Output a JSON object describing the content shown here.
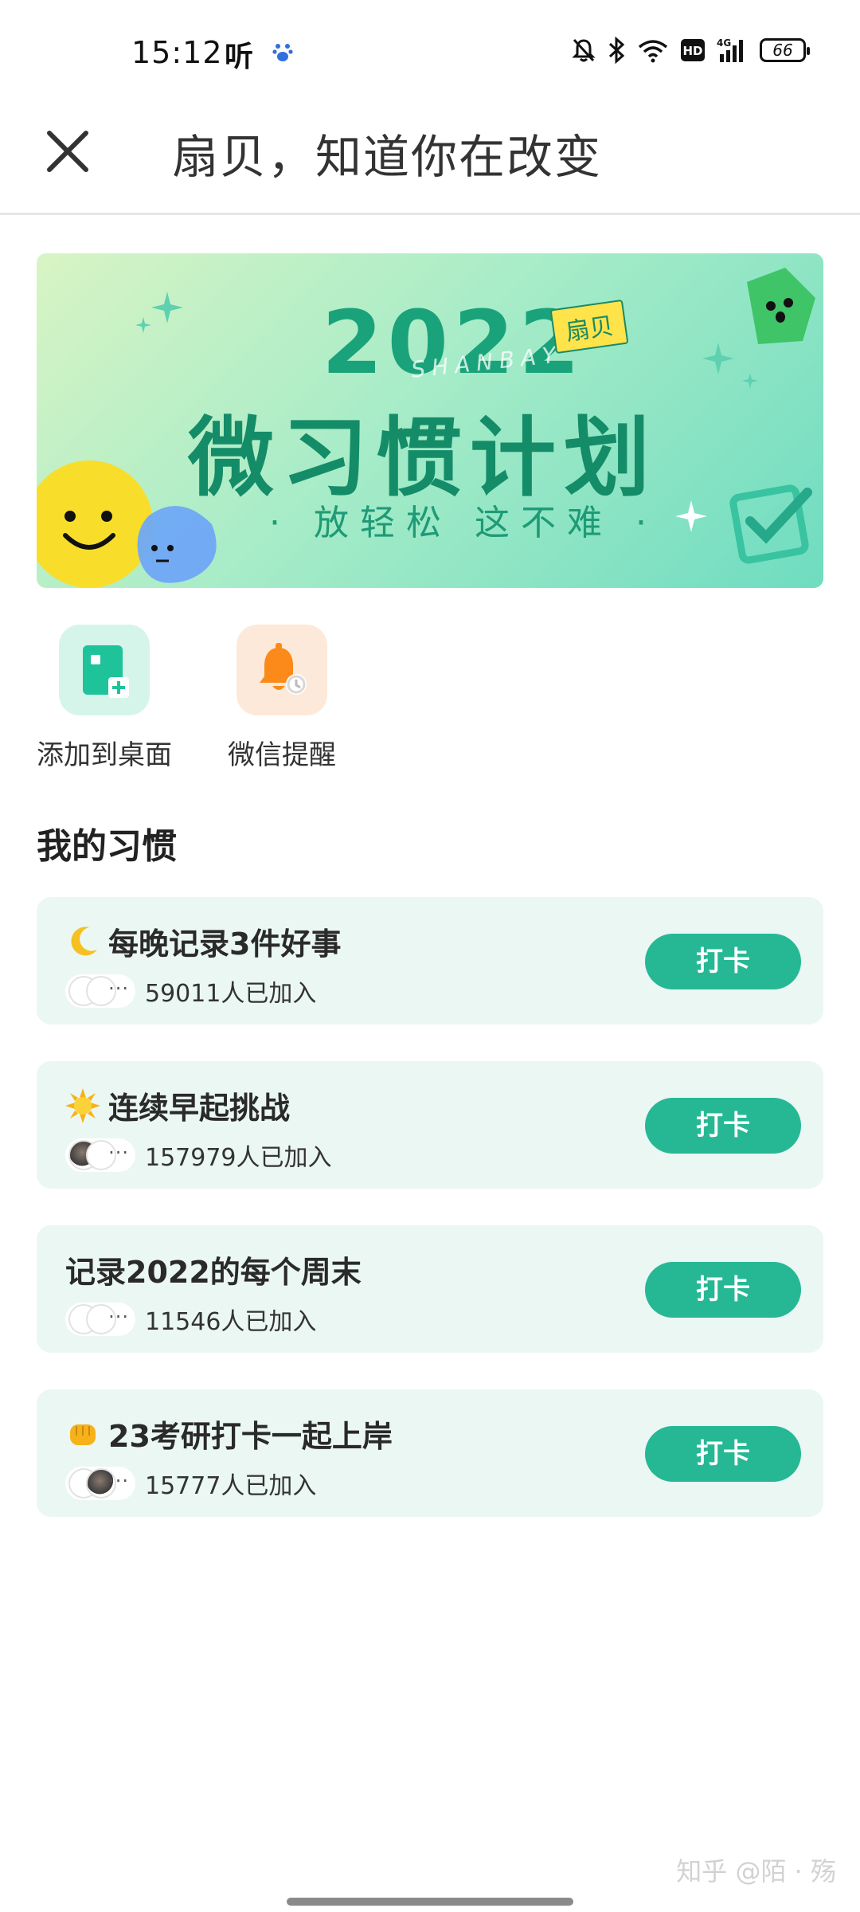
{
  "status_bar": {
    "time": "15:12",
    "app_icon_1": "听",
    "battery": "66"
  },
  "header": {
    "title": "扇贝，知道你在改变"
  },
  "banner": {
    "year": "2022",
    "brand": "SHANBAY",
    "tag": "扇贝",
    "main_text": "微习惯计划",
    "sub_text": "· 放轻松  这不难 ·"
  },
  "quick_actions": [
    {
      "label": "添加到桌面",
      "icon": "add-to-desktop-icon"
    },
    {
      "label": "微信提醒",
      "icon": "bell-icon"
    }
  ],
  "section": {
    "title": "我的习惯"
  },
  "habits": [
    {
      "emoji": "crescent-moon",
      "title": "每晚记录3件好事",
      "count": "59011人已加入",
      "button": "打卡"
    },
    {
      "emoji": "sun",
      "title": "连续早起挑战",
      "count": "157979人已加入",
      "button": "打卡"
    },
    {
      "emoji": "",
      "title": "记录2022的每个周末",
      "count": "11546人已加入",
      "button": "打卡"
    },
    {
      "emoji": "fist",
      "title": "23考研打卡一起上岸",
      "count": "15777人已加入",
      "button": "打卡"
    }
  ],
  "more_glyph": "···",
  "watermark": "知乎 @陌 · 殇",
  "colors": {
    "accent": "#26b894",
    "card_bg": "#ebf7f3",
    "banner_text": "#148c68"
  }
}
